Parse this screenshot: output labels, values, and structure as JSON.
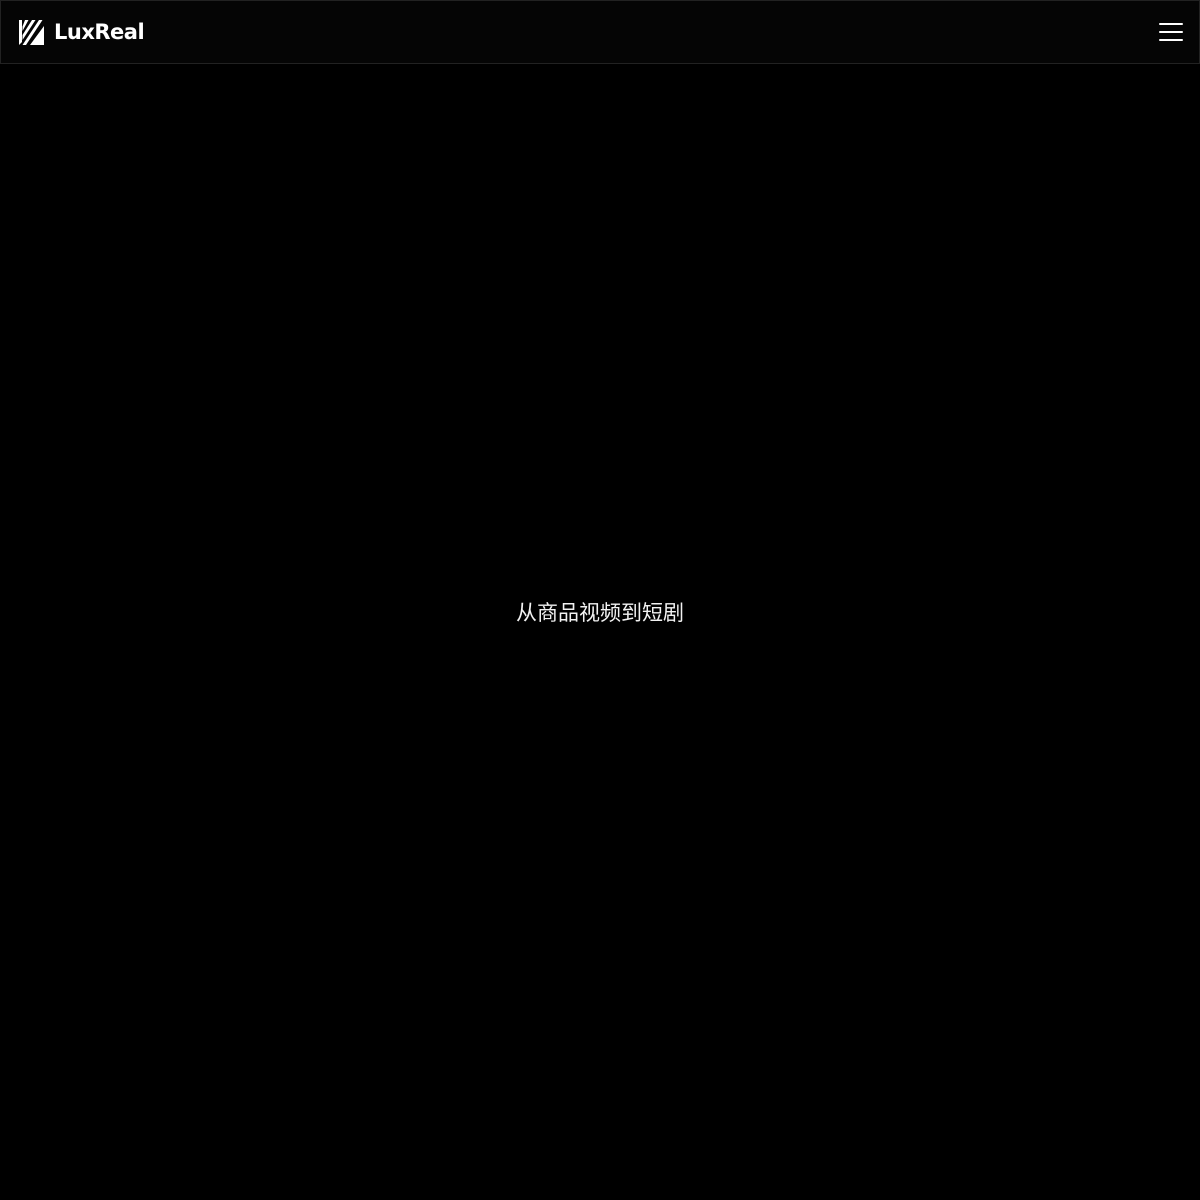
{
  "header": {
    "brand_name": "LuxReal",
    "logo_icon": "luxreal-logo-icon",
    "menu_icon": "hamburger-menu-icon"
  },
  "hero": {
    "tagline": "从商品视频到短剧"
  },
  "colors": {
    "background": "#000000",
    "text": "#ffffff",
    "header_border": "#222222"
  }
}
